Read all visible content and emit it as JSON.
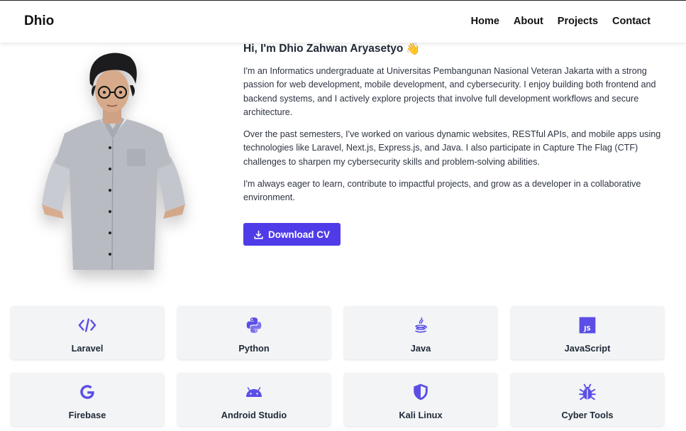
{
  "nav": {
    "brand": "Dhio",
    "links": [
      "Home",
      "About",
      "Projects",
      "Contact"
    ]
  },
  "about": {
    "greeting": "Hi, I'm Dhio Zahwan Aryasetyo",
    "wave": "👋",
    "paragraphs": [
      "I'm an Informatics undergraduate at Universitas Pembangunan Nasional Veteran Jakarta with a strong passion for web development, mobile development, and cybersecurity. I enjoy building both frontend and backend systems, and I actively explore projects that involve full development workflows and secure architecture.",
      "Over the past semesters, I've worked on various dynamic websites, RESTful APIs, and mobile apps using technologies like Laravel, Next.js, Express.js, and Java. I also participate in Capture The Flag (CTF) challenges to sharpen my cybersecurity skills and problem-solving abilities.",
      "I'm always eager to learn, contribute to impactful projects, and grow as a developer in a collaborative environment."
    ],
    "download_label": "Download CV"
  },
  "skills": [
    {
      "label": "Laravel",
      "icon": "code-icon"
    },
    {
      "label": "Python",
      "icon": "python-icon"
    },
    {
      "label": "Java",
      "icon": "java-icon"
    },
    {
      "label": "JavaScript",
      "icon": "javascript-icon"
    },
    {
      "label": "Firebase",
      "icon": "google-icon"
    },
    {
      "label": "Android Studio",
      "icon": "android-icon"
    },
    {
      "label": "Kali Linux",
      "icon": "shield-icon"
    },
    {
      "label": "Cyber Tools",
      "icon": "bug-icon"
    }
  ],
  "colors": {
    "accent": "#4f3ce8",
    "icon": "#5b4ee6",
    "card": "#f3f4f6"
  }
}
